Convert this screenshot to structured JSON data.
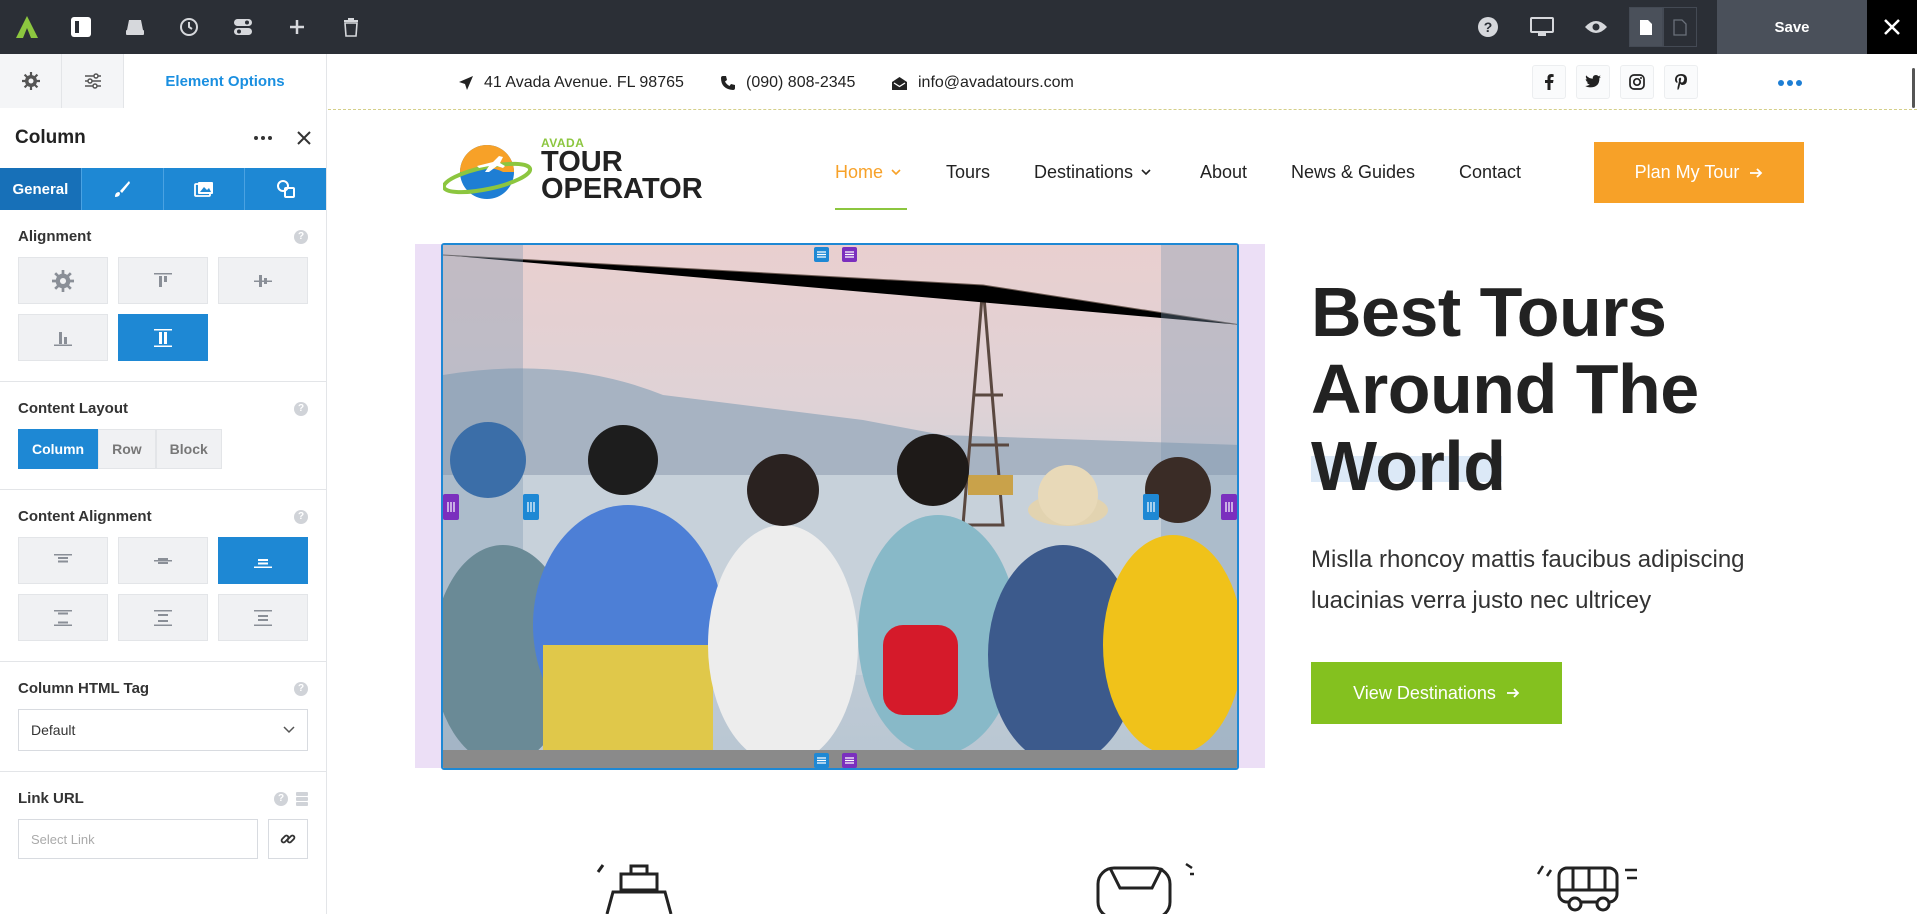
{
  "app": {
    "save_label": "Save"
  },
  "panel": {
    "tab_element_options": "Element Options",
    "title": "Column",
    "general_tab": "General",
    "sections": {
      "alignment": "Alignment",
      "content_layout": "Content Layout",
      "content_alignment": "Content Alignment",
      "html_tag": "Column HTML Tag",
      "link_url": "Link URL"
    },
    "content_layout_options": [
      "Column",
      "Row",
      "Block"
    ],
    "html_tag_value": "Default",
    "link_placeholder": "Select Link"
  },
  "site": {
    "address": "41 Avada Avenue. FL 98765",
    "phone": "(090) 808-2345",
    "email": "info@avadatours.com",
    "logo_small": "AVADA",
    "logo_line1": "TOUR",
    "logo_line2": "OPERATOR",
    "nav": [
      "Home",
      "Tours",
      "Destinations",
      "About",
      "News & Guides",
      "Contact"
    ],
    "cta": "Plan My Tour",
    "headline": [
      "Best Tours",
      "Around The",
      "World"
    ],
    "description_lines": [
      "Mislla rhoncoy mattis faucibus adipiscing",
      "luacinias verra justo nec ultricey"
    ],
    "view_button": "View Destinations"
  },
  "colors": {
    "toolbar_bg": "#2b2f36",
    "accent_blue": "#1e88d4",
    "orange": "#f7a128",
    "green": "#84c11f",
    "purple": "#7b2fbe"
  }
}
